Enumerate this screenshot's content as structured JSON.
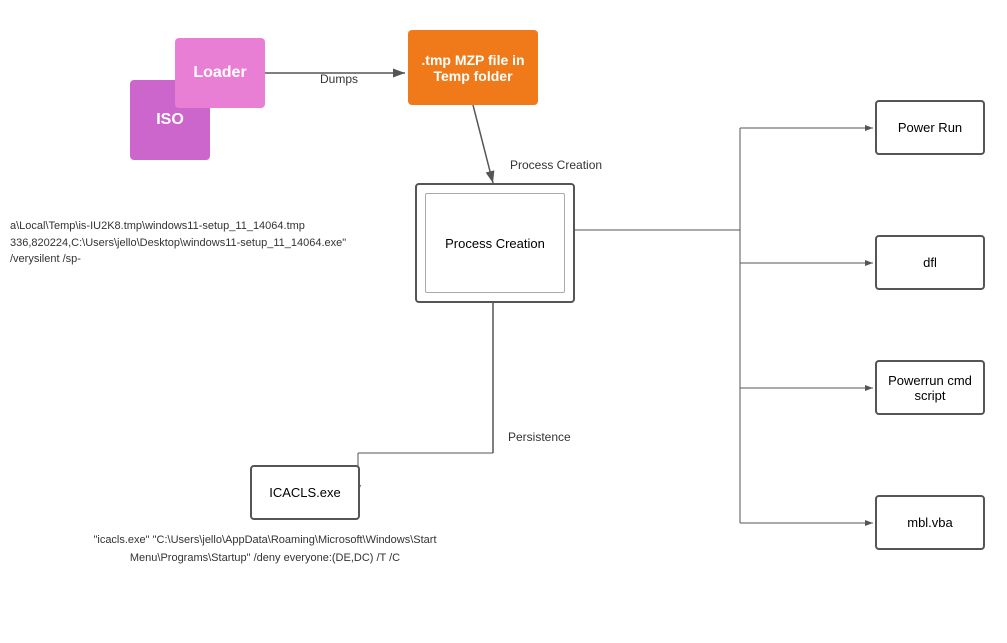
{
  "nodes": {
    "iso": {
      "label": "ISO"
    },
    "loader": {
      "label": "Loader"
    },
    "tmp": {
      "label": ".tmp MZP file in Temp folder"
    },
    "processCreation": {
      "label": "Process Creation"
    },
    "icacls": {
      "label": "ICACLS.exe"
    },
    "powerRun": {
      "label": "Power Run"
    },
    "dfl": {
      "label": "dfl"
    },
    "powerrunCmd": {
      "label": "Powerrun cmd script"
    },
    "mblVba": {
      "label": "mbl.vba"
    }
  },
  "labels": {
    "dumps": "Dumps",
    "processCreationTop": "Process Creation",
    "persistence": "Persistence",
    "command": "a\\Local\\Temp\\is-IU2K8.tmp\\windows11-setup_11_14064.tmp\n336,820224,C:\\Users\\jello\\Desktop\\windows11-setup_11_14064.exe\"\n/verysilent /sp-",
    "icaclsCmd": "\"icacls.exe\" \"C:\\Users\\jello\\AppData\\Roaming\\Microsoft\\Windows\\Start\nMenu\\Programs\\Startup\" /deny everyone:(DE,DC) /T /C"
  }
}
